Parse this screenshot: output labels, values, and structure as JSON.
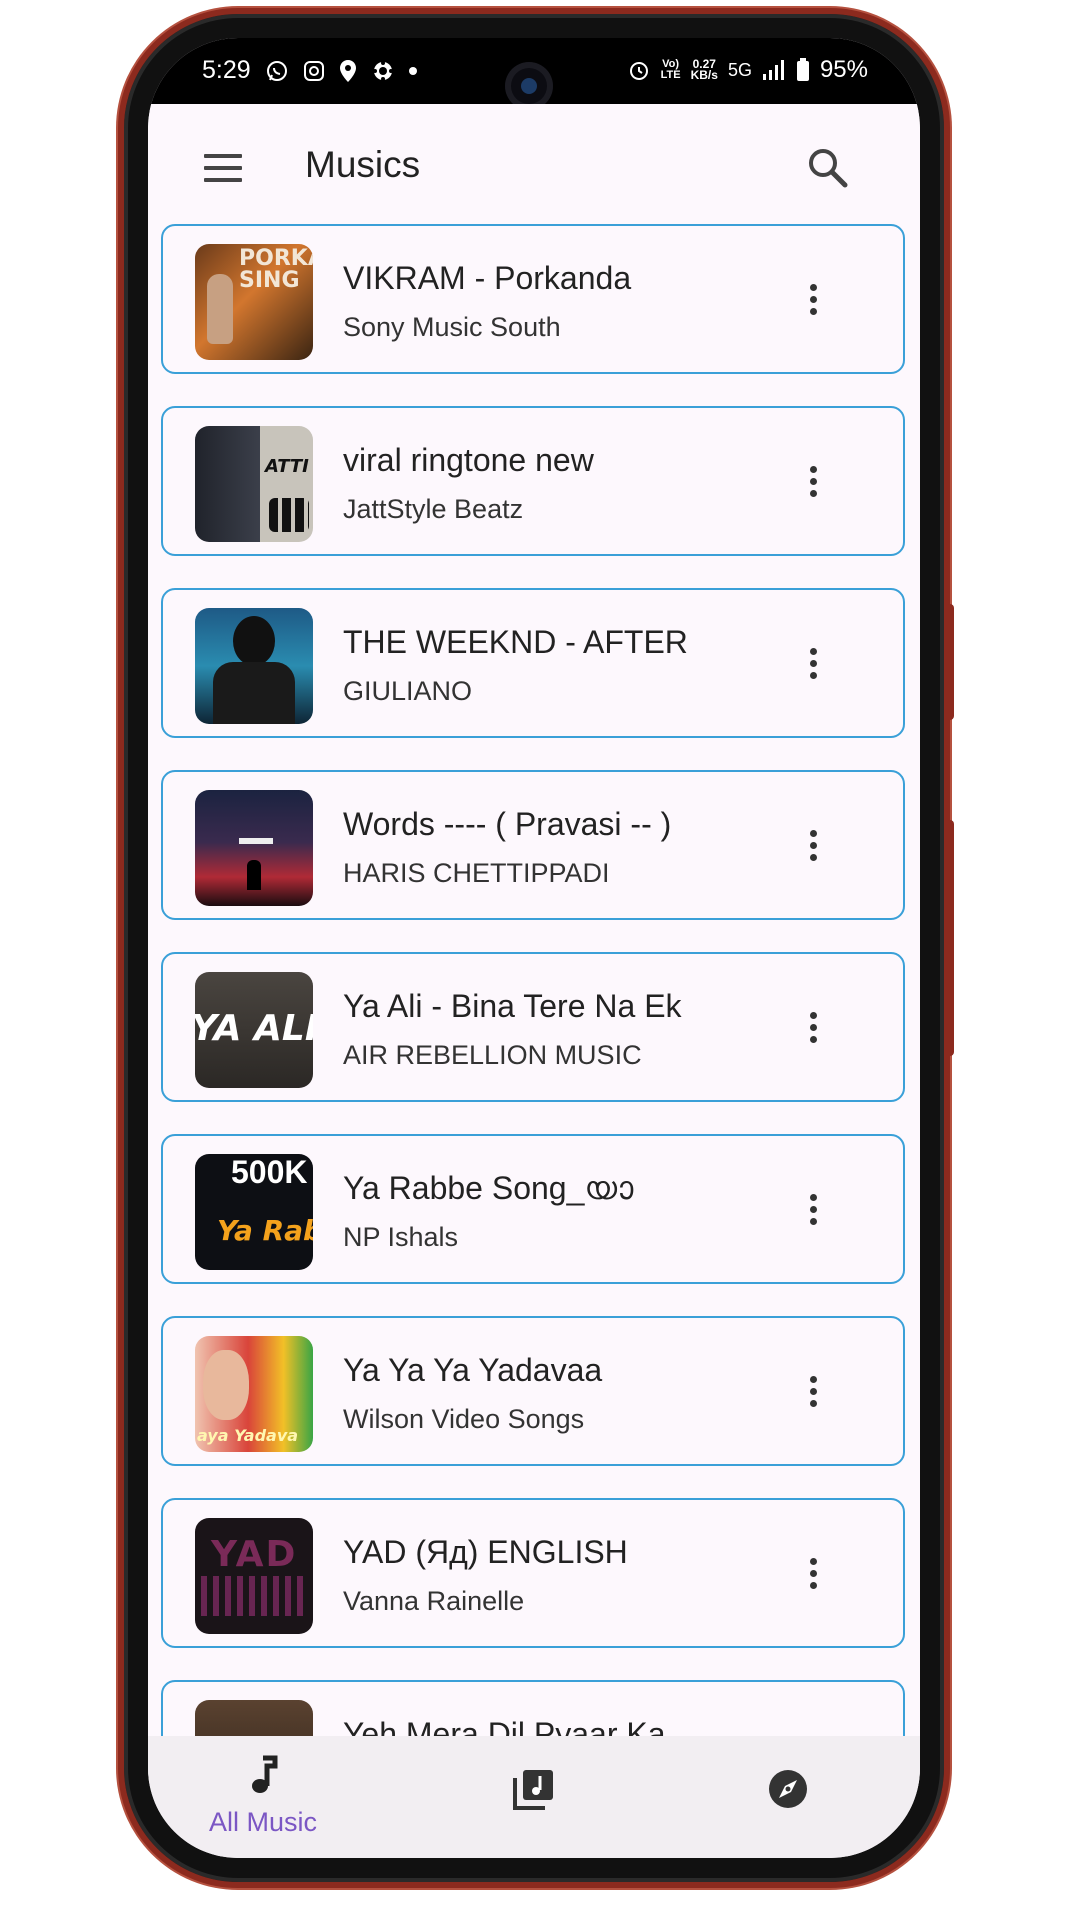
{
  "status_bar": {
    "time": "5:29",
    "net_speed_top": "0.27",
    "net_speed_bottom": "KB/s",
    "network": "5G",
    "volte_top": "Vo)",
    "volte_bottom": "LTE",
    "battery": "95%"
  },
  "header": {
    "title": "Musics",
    "menu_icon": "hamburger-menu-icon",
    "search_icon": "search-icon"
  },
  "songs": [
    {
      "title": "VIKRAM - Porkanda",
      "artist": "Sony Music South",
      "thumb_text": "PORKA SING"
    },
    {
      "title": "viral ringtone new",
      "artist": "JattStyle Beatz",
      "thumb_text": "ATTI"
    },
    {
      "title": "THE WEEKND - AFTER",
      "artist": "GIULIANO",
      "thumb_text": ""
    },
    {
      "title": "Words ---- ( Pravasi -- )",
      "artist": "HARIS CHETTIPPADI",
      "thumb_text": ""
    },
    {
      "title": "Ya Ali - Bina Tere Na Ek",
      "artist": "AIR REBELLION MUSIC",
      "thumb_text": "YA ALI"
    },
    {
      "title": "Ya Rabbe Song_യാ",
      "artist": "NP Ishals",
      "thumb_text": "Ya Rab"
    },
    {
      "title": "Ya Ya Ya Yadavaa",
      "artist": "Wilson Video Songs",
      "thumb_text": "aya Yadava"
    },
    {
      "title": "YAD (Яд) ENGLISH",
      "artist": "Vanna Rainelle",
      "thumb_text": "YAD"
    },
    {
      "title": "Yeh Mera Dil Pyaar Ka",
      "artist": "",
      "thumb_text": ""
    }
  ],
  "bottom_nav": {
    "items": [
      {
        "label": "All Music",
        "icon": "music-note-icon",
        "active": true
      },
      {
        "label": "",
        "icon": "library-music-icon",
        "active": false
      },
      {
        "label": "",
        "icon": "compass-explore-icon",
        "active": false
      }
    ]
  },
  "colors": {
    "accent": "#7b56c4",
    "card_border": "#3aa0d8",
    "background": "#fdf8fd",
    "phone_frame": "#8c2a1e"
  }
}
